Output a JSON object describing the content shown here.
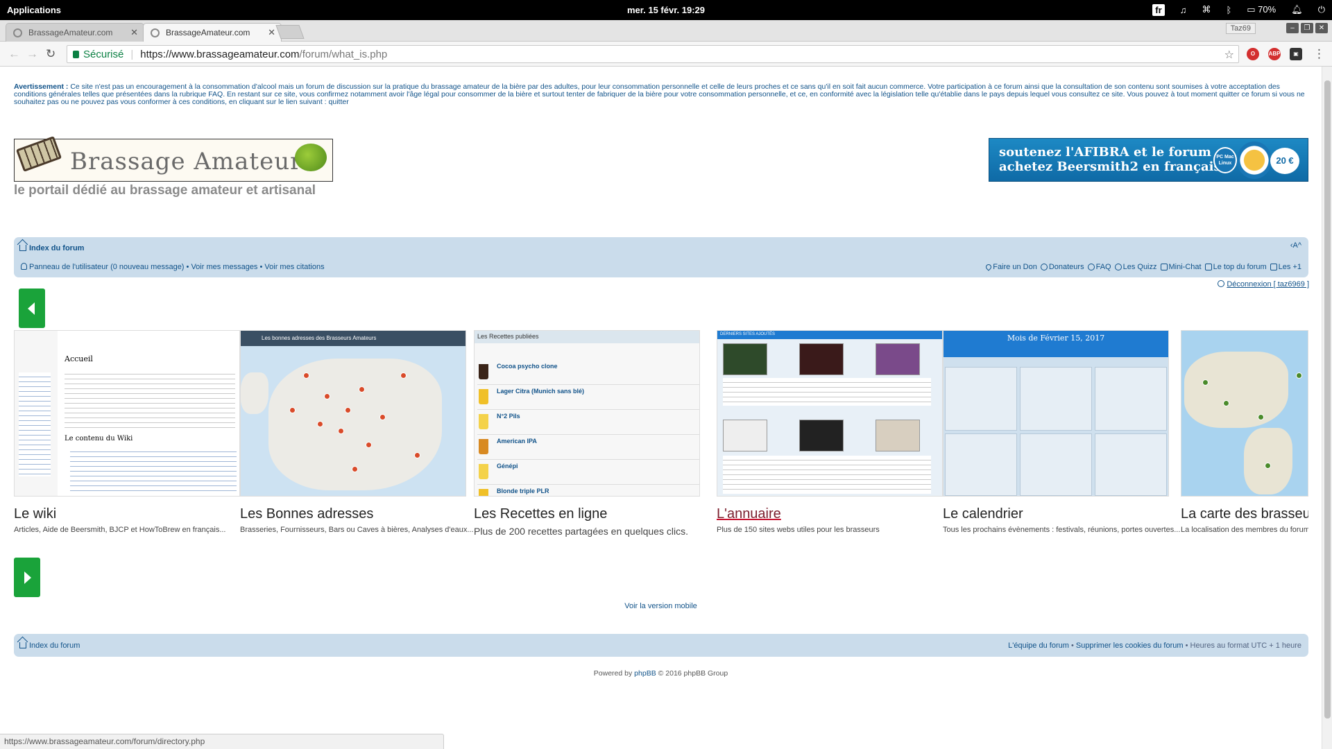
{
  "os": {
    "applications": "Applications",
    "clock": "mer. 15 févr.  19:29",
    "lang": "fr",
    "battery": "70%"
  },
  "browser": {
    "tabs": [
      {
        "title": "BrassageAmateur.com",
        "active": false
      },
      {
        "title": "BrassageAmateur.com",
        "active": true
      }
    ],
    "profile": "Taz69",
    "secure_label": "Sécurisé",
    "url_host": "https://www.brassageamateur.com",
    "url_path": "/forum/what_is.php",
    "status_url": "https://www.brassageamateur.com/forum/directory.php"
  },
  "warning": {
    "label": "Avertissement :",
    "text": " Ce site n'est pas un encouragement à la consommation d'alcool mais un forum de discussion sur la pratique du brassage amateur de la bière par des adultes, pour leur consommation personnelle et celle de leurs proches et ce sans qu'il en soit fait aucun commerce. Votre participation à ce forum ainsi que la consultation de son contenu sont soumises à votre acceptation des conditions générales telles que présentées dans la rubrique ",
    "faq": "FAQ",
    "text2": ". En restant sur ce site, vous confirmez notamment avoir l'âge légal pour consommer de la bière et surtout tenter de fabriquer de la bière pour votre consommation personnelle, et ce, en conformité avec la législation telle qu'établie dans le pays depuis lequel vous consultez ce site. Vous pouvez à tout moment quitter ce forum si vous ne souhaitez pas ou ne pouvez pas vous conformer à ces conditions, en cliquant sur le lien suivant : ",
    "quit": "quitter"
  },
  "header": {
    "logo_text": "Brassage Amateur",
    "tagline": "le portail dédié au brassage amateur et artisanal",
    "banner_line1": "soutenez l'AFIBRA et le forum",
    "banner_line2": "achetez Beersmith2 en français",
    "banner_badge": "PC Mac Linux",
    "banner_price": "20 €"
  },
  "nav": {
    "index": "Index du forum",
    "fontsize": "‹A^",
    "panel": "Panneau de l'utilisateur",
    "panel_count": "(0 nouveau message)",
    "sep": " • ",
    "my_messages": "Voir mes messages",
    "my_citations": "Voir mes citations",
    "links": [
      "Faire un Don",
      "Donateurs",
      "FAQ",
      "Les Quizz",
      "Mini-Chat",
      "Le top du forum",
      "Les +1"
    ],
    "logout": "Déconnexion [ taz6969 ]"
  },
  "cards": [
    {
      "title": "Le wiki",
      "desc": "Articles, Aide de Beersmith, BJCP et HowToBrew en français...",
      "thumb_heading": "Accueil",
      "thumb_sub": "Le contenu du Wiki"
    },
    {
      "title": "Les Bonnes adresses",
      "desc": "Brasseries, Fournisseurs, Bars ou Caves à bières, Analyses d'eaux...",
      "thumb_heading": "Les bonnes adresses des Brasseurs Amateurs"
    },
    {
      "title": "Les Recettes en ligne",
      "desc": "Plus de 200 recettes partagées en quelques clics.",
      "thumb_heading": "Les Recettes publiées",
      "recipes": [
        "Cocoa psycho clone",
        "Lager Citra (Munich sans blé)",
        "N°2 Pils",
        "American IPA",
        "Génépi",
        "Blonde triple PLR"
      ]
    },
    {
      "title": "L'annuaire",
      "desc": "Plus de 150 sites webs utiles pour les brasseurs",
      "thumb_heading": "DERNIERS SITES AJOUTÉS"
    },
    {
      "title": "Le calendrier",
      "desc": "Tous les prochains évènements : festivals, réunions, portes ouvertes...",
      "thumb_heading": "Mois de Février 15, 2017"
    },
    {
      "title": "La carte des brasseurs",
      "desc": "La localisation des membres du forum"
    }
  ],
  "mobile_link": "Voir la version mobile",
  "footer": {
    "index": "Index du forum",
    "team": "L'équipe du forum",
    "sep": " • ",
    "cookies": "Supprimer les cookies du forum",
    "tz": " • Heures au format UTC + 1 heure",
    "powered_pre": "Powered by ",
    "phpbb": "phpBB",
    "powered_post": " © 2016 phpBB Group"
  },
  "colors": {
    "navbar": "#cadceb",
    "link": "#105289",
    "arrow_green": "#1aa33a",
    "banner_blue": "#1d89c4"
  },
  "icons": [
    "search-icon",
    "star-icon",
    "heart-icon",
    "question-icon",
    "chat-icon",
    "house-icon",
    "power-icon"
  ]
}
